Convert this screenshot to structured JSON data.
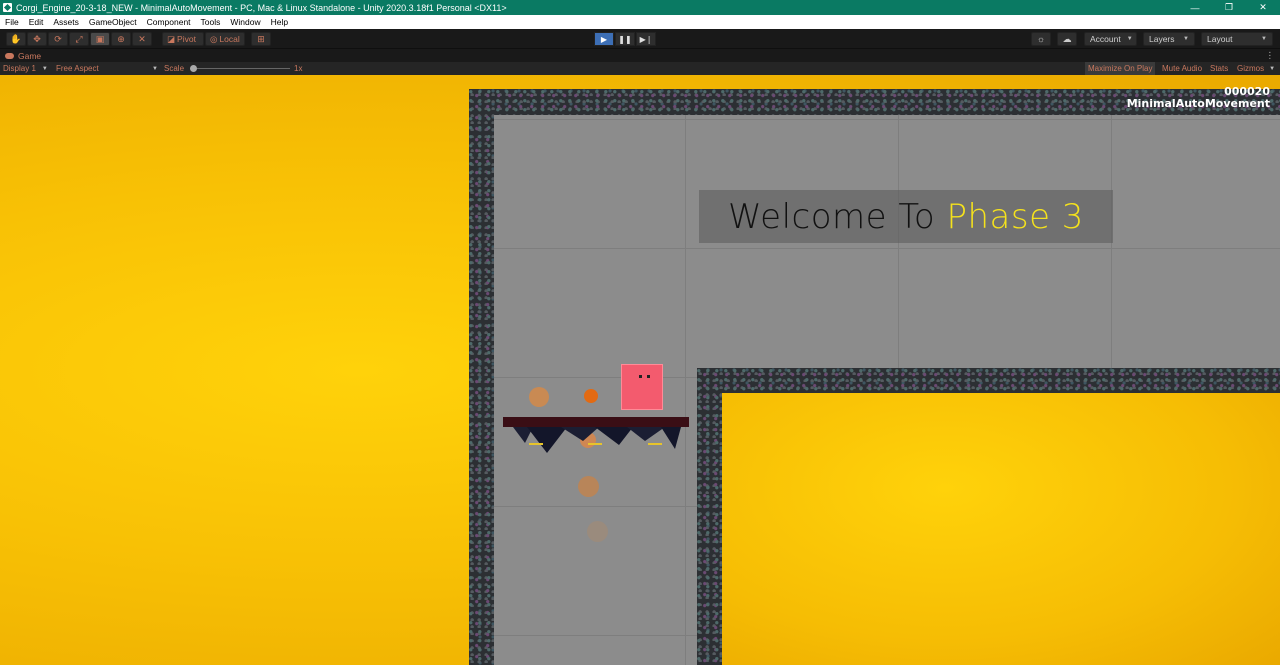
{
  "window": {
    "title": "Corgi_Engine_20-3-18_NEW - MinimalAutoMovement - PC, Mac & Linux Standalone - Unity 2020.3.18f1 Personal <DX11>",
    "controls": [
      "—",
      "❐",
      "✕"
    ]
  },
  "menu": [
    "File",
    "Edit",
    "Assets",
    "GameObject",
    "Component",
    "Tools",
    "Window",
    "Help"
  ],
  "toolbar": {
    "tools": [
      "hand-tool",
      "move-tool",
      "rotate-tool",
      "scale-tool",
      "rect-tool",
      "transform-tool",
      "custom-tool"
    ],
    "pivot_label": "Pivot",
    "local_label": "Local",
    "account_label": "Account",
    "layers_label": "Layers",
    "layout_label": "Layout"
  },
  "game_tab": {
    "label": "Game"
  },
  "game_toolbar": {
    "display": "Display 1",
    "aspect": "Free Aspect",
    "scale_label": "Scale",
    "scale_value": "1x",
    "maximize": "Maximize On Play",
    "mute": "Mute Audio",
    "stats": "Stats",
    "gizmos": "Gizmos"
  },
  "game": {
    "score": "000020",
    "level_name": "MinimalAutoMovement",
    "welcome_prefix": "Welcome To ",
    "welcome_highlight": "Phase 3",
    "colors": {
      "background": "#f8c105",
      "highlight": "#f5e21c",
      "player": "#f35b6e",
      "wall": "#2c2f33"
    }
  }
}
